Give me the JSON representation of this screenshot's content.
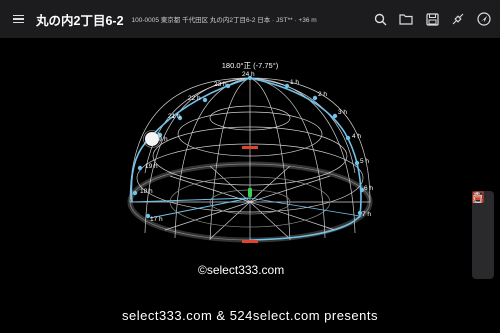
{
  "header": {
    "title": "丸の内2丁目6-2",
    "subtitle": "100-0005 東京都 千代田区 丸の内2丁目6-2 日本 · JST** · +36 m",
    "icons": [
      "search-icon",
      "folder-icon",
      "save-icon",
      "satellite-icon",
      "navigation-icon"
    ]
  },
  "sun": {
    "label": "180.0°正 (-7.75°)"
  },
  "hours": [
    "24 h",
    "1 h",
    "2 h",
    "3 h",
    "4 h",
    "5 h",
    "6 h",
    "7 h",
    "17 h",
    "18 h",
    "19 h",
    "20 h",
    "21 h",
    "22 h",
    "23 h"
  ],
  "side_panel": {
    "icons": [
      "share-icon",
      "sun-rise-icon",
      "sun-off-icon",
      "hand-icon"
    ]
  },
  "watermark": "©select333.com",
  "footer": "select333.com & 524select.com presents",
  "colors": {
    "path": "#6fc3ea",
    "grid": "#d8d8d8",
    "accent": "#e0452b"
  }
}
